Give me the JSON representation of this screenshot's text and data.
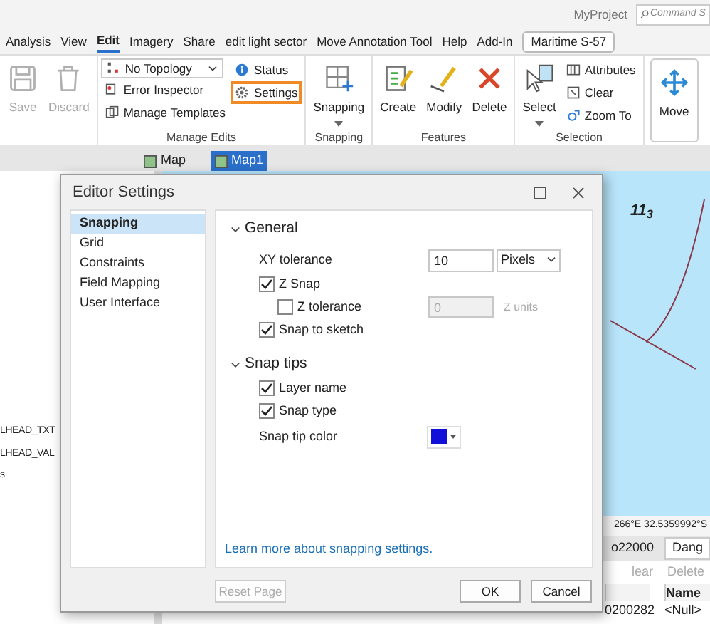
{
  "title_bar": {
    "project": "MyProject",
    "search_placeholder": "Command S"
  },
  "menu_tabs": [
    {
      "label": "Analysis",
      "selected": false,
      "kind": "plain"
    },
    {
      "label": "View",
      "selected": false,
      "kind": "plain"
    },
    {
      "label": "Edit",
      "selected": true,
      "kind": "plain"
    },
    {
      "label": "Imagery",
      "selected": false,
      "kind": "plain"
    },
    {
      "label": "Share",
      "selected": false,
      "kind": "plain"
    },
    {
      "label": "edit light sector",
      "selected": false,
      "kind": "plain"
    },
    {
      "label": "Move Annotation Tool",
      "selected": false,
      "kind": "plain"
    },
    {
      "label": "Help",
      "selected": false,
      "kind": "plain"
    },
    {
      "label": "Add-In",
      "selected": false,
      "kind": "plain"
    },
    {
      "label": "Maritime S-57",
      "selected": false,
      "kind": "boxed"
    }
  ],
  "ribbon": [
    {
      "boxed": false,
      "columns": [
        [
          {
            "label": "Save",
            "kind": "large",
            "disabled": true,
            "highlighted": false
          }
        ],
        [
          {
            "label": "Discard",
            "kind": "large",
            "disabled": true,
            "highlighted": false
          }
        ]
      ]
    },
    {
      "title": "Manage Edits",
      "boxed": false,
      "columns": [
        [
          {
            "label": "No Topology",
            "kind": "combo",
            "disabled": false,
            "highlighted": false
          },
          {
            "label": "Error Inspector",
            "kind": "small",
            "disabled": false,
            "highlighted": false
          },
          {
            "label": "Manage Templates",
            "kind": "small",
            "disabled": false,
            "highlighted": false
          }
        ],
        [
          {
            "label": "Status",
            "kind": "small",
            "disabled": false,
            "highlighted": false
          },
          {
            "label": "Settings",
            "kind": "small",
            "disabled": false,
            "highlighted": true
          }
        ]
      ]
    },
    {
      "title": "Snapping",
      "boxed": false,
      "columns": [
        [
          {
            "label": "Snapping",
            "kind": "large",
            "caret": true,
            "disabled": false,
            "highlighted": false
          }
        ]
      ]
    },
    {
      "title": "Features",
      "boxed": false,
      "columns": [
        [
          {
            "label": "Create",
            "kind": "large",
            "disabled": false,
            "highlighted": false
          }
        ],
        [
          {
            "label": "Modify",
            "kind": "large",
            "disabled": false,
            "highlighted": false
          }
        ],
        [
          {
            "label": "Delete",
            "kind": "large",
            "disabled": false,
            "highlighted": false
          }
        ]
      ]
    },
    {
      "title": "Selection",
      "boxed": false,
      "columns": [
        [
          {
            "label": "Select",
            "kind": "large",
            "caret": true,
            "disabled": false,
            "highlighted": false
          }
        ],
        [
          {
            "label": "Attributes",
            "kind": "small",
            "disabled": false,
            "highlighted": false
          },
          {
            "label": "Clear",
            "kind": "small",
            "disabled": false,
            "highlighted": false
          },
          {
            "label": "Zoom To",
            "kind": "small",
            "disabled": false,
            "highlighted": false
          }
        ]
      ]
    },
    {
      "boxed": true,
      "columns": [
        [
          {
            "label": "Move",
            "kind": "large",
            "disabled": false,
            "highlighted": false
          }
        ]
      ]
    }
  ],
  "doc_tabs": [
    {
      "label": "Map",
      "selected": false
    },
    {
      "label": "Map1",
      "selected": true
    }
  ],
  "left_pane": {
    "rows": [
      "LHEAD_TXT",
      "LHEAD_VAL",
      "s"
    ]
  },
  "map": {
    "label": "11$_{3}$",
    "coordinates": "266°E 32.5359992°S"
  },
  "bottom_tabs": [
    {
      "label": "o22000",
      "selected": false
    },
    {
      "label": "Dang",
      "selected": true
    }
  ],
  "table_toolbar": [
    {
      "label": "lear",
      "disabled": true
    },
    {
      "label": "Delete",
      "disabled": true
    }
  ],
  "table": {
    "columns": [
      "",
      "Name"
    ],
    "rows": [
      {
        "cells": [
          "0200282",
          "<Null>"
        ]
      }
    ]
  },
  "dialog": {
    "title": "Editor Settings",
    "nav": [
      {
        "label": "Snapping",
        "selected": true
      },
      {
        "label": "Grid",
        "selected": false
      },
      {
        "label": "Constraints",
        "selected": false
      },
      {
        "label": "Field Mapping",
        "selected": false
      },
      {
        "label": "User Interface",
        "selected": false
      }
    ],
    "sections": [
      {
        "title": "General",
        "expanded": true,
        "rows": [
          {
            "kind": "input",
            "label": "XY tolerance",
            "value": "10",
            "unit_select": "Pixels",
            "disabled": false
          },
          {
            "kind": "checkbox",
            "label": "Z Snap",
            "checked": true,
            "indented": false
          },
          {
            "kind": "checkbox_input",
            "label": "Z tolerance",
            "checked": false,
            "indented": true,
            "value": "0",
            "unit": "Z units",
            "disabled": true
          },
          {
            "kind": "checkbox",
            "label": "Snap to sketch",
            "checked": true,
            "indented": false
          }
        ]
      },
      {
        "title": "Snap tips",
        "expanded": true,
        "rows": [
          {
            "kind": "checkbox",
            "label": "Layer name",
            "checked": true,
            "indented": false
          },
          {
            "kind": "checkbox",
            "label": "Snap type",
            "checked": true,
            "indented": false
          },
          {
            "kind": "color",
            "label": "Snap tip color",
            "color": "#1010d8"
          }
        ]
      }
    ],
    "link": "Learn more about snapping settings.",
    "buttons": [
      {
        "label": "Reset Page",
        "disabled": true
      },
      {
        "label": "OK",
        "disabled": false
      },
      {
        "label": "Cancel",
        "disabled": false
      }
    ]
  }
}
